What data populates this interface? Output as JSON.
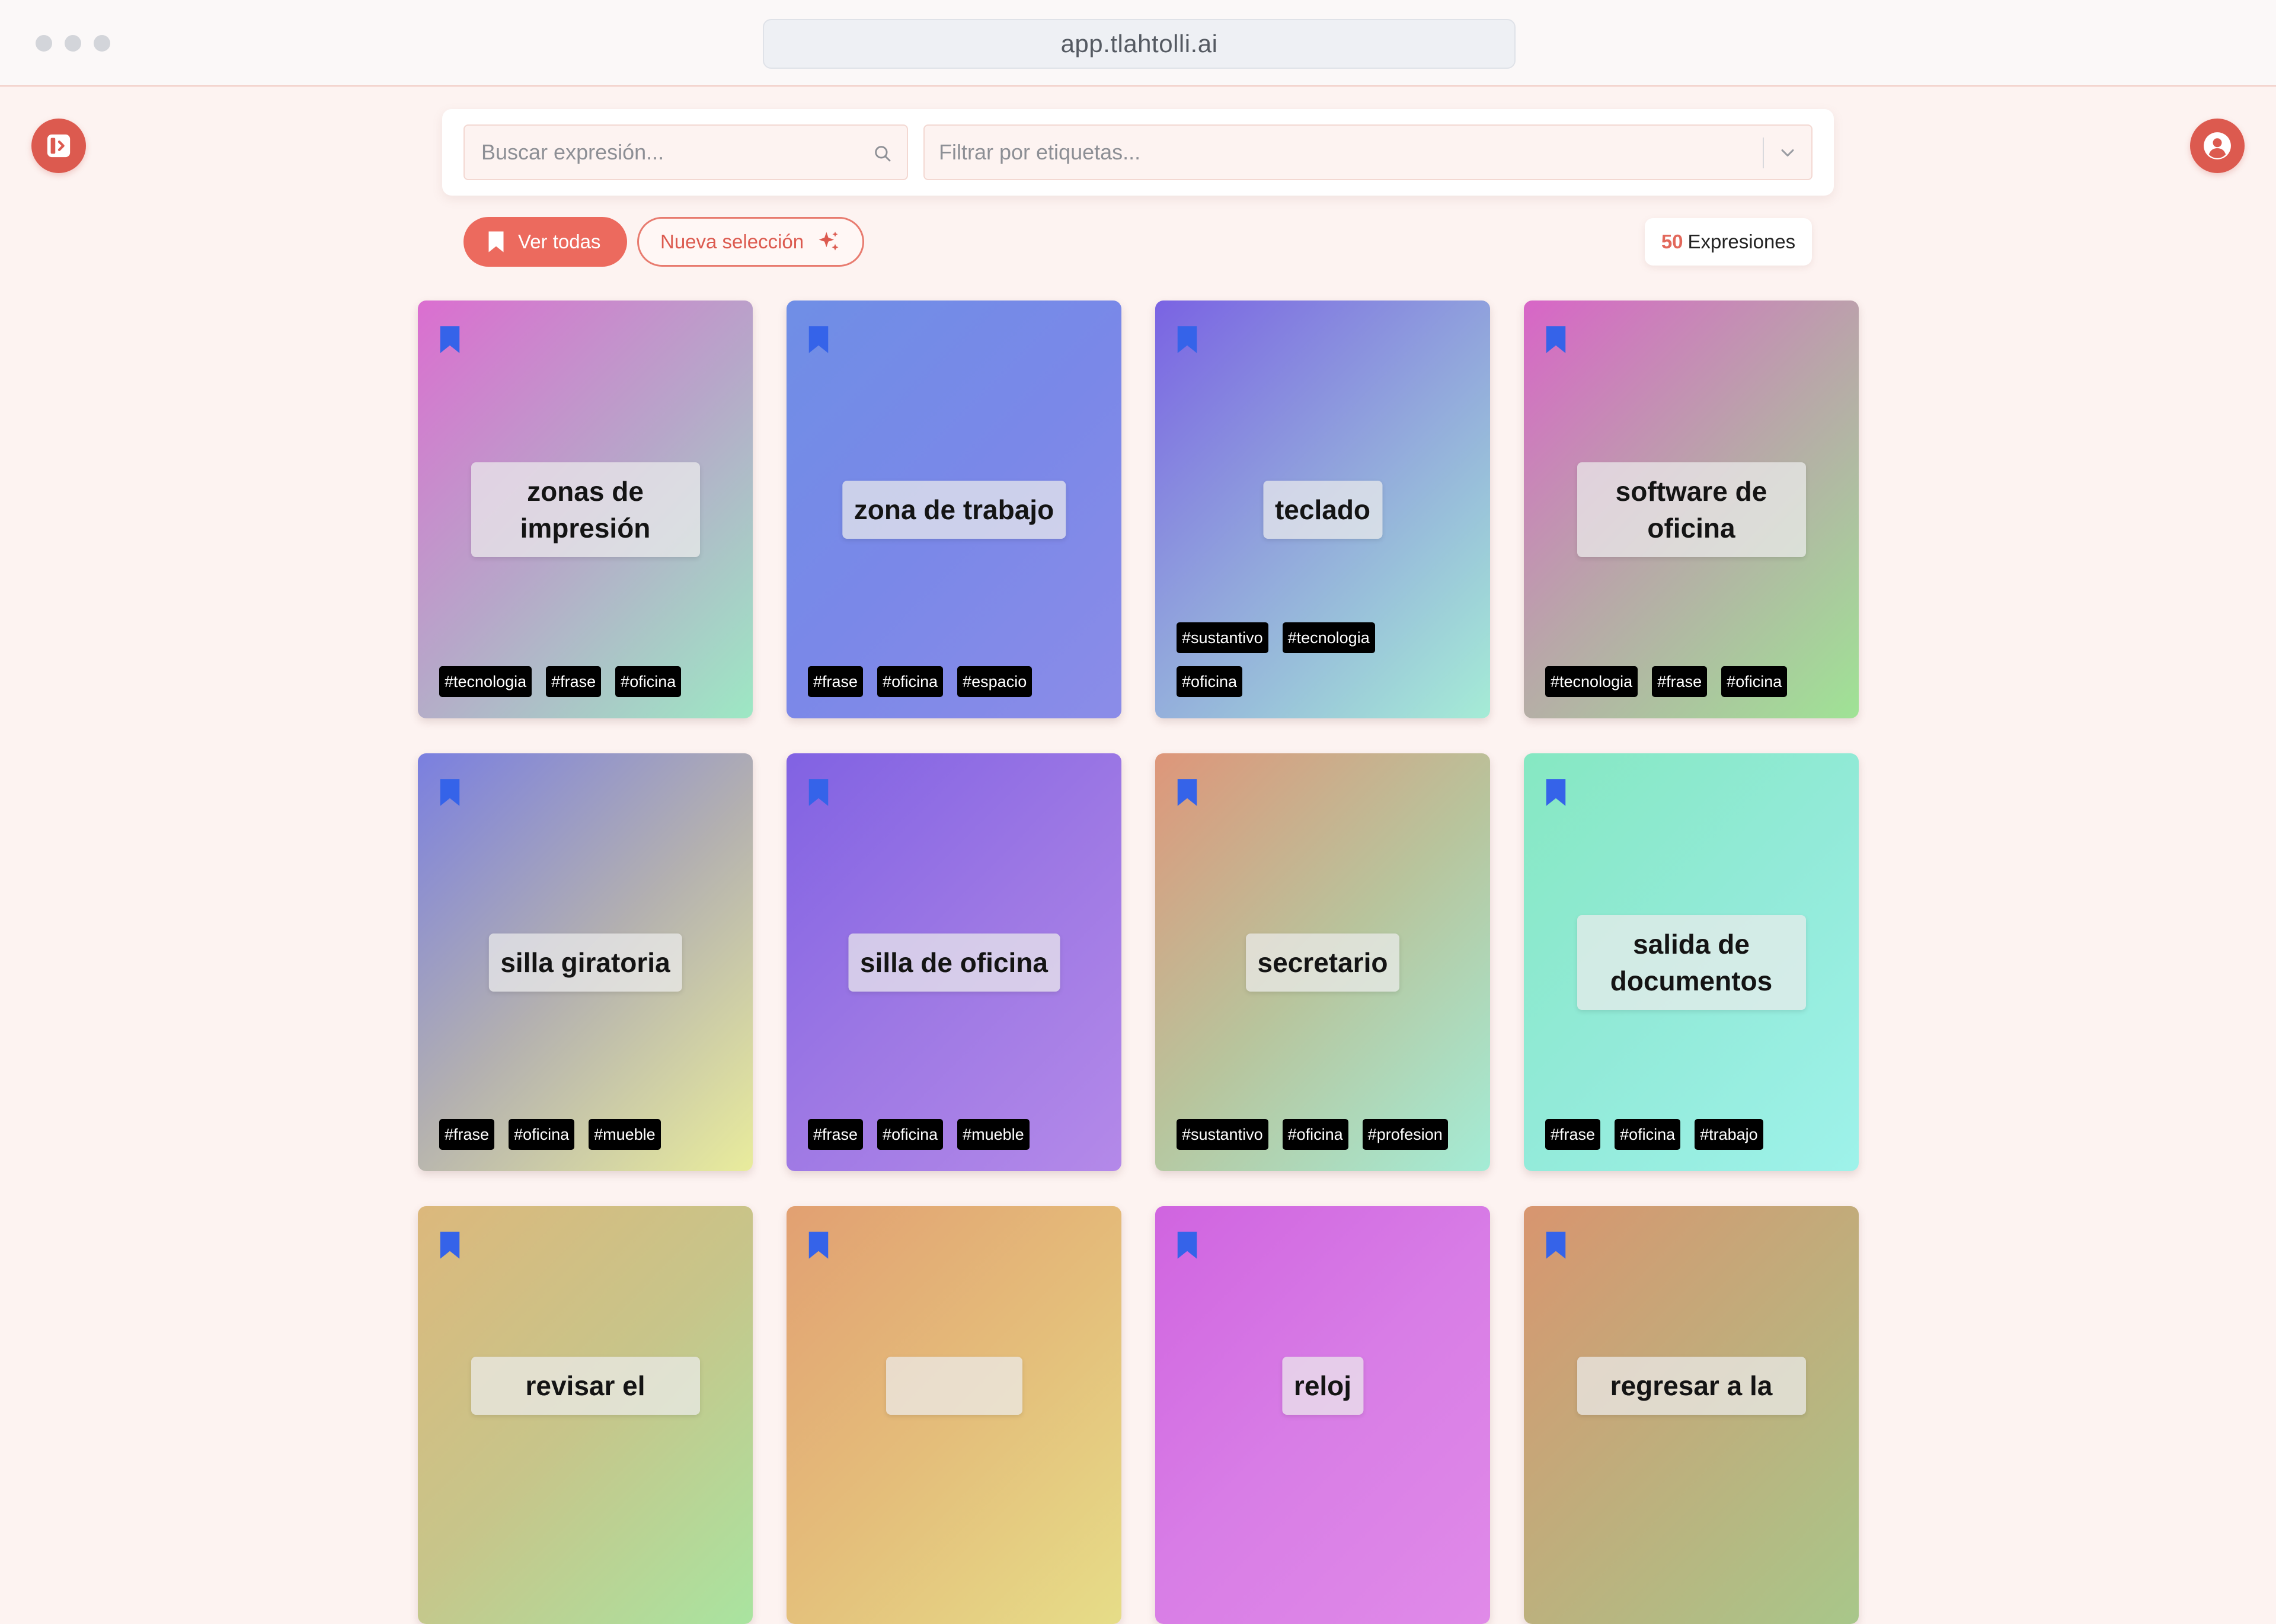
{
  "browser": {
    "url": "app.tlahtolli.ai"
  },
  "search": {
    "placeholder": "Buscar expresión...",
    "tag_filter_placeholder": "Filtrar por etiquetas..."
  },
  "actions": {
    "view_all_label": "Ver todas",
    "new_selection_label": "Nueva selección"
  },
  "counter": {
    "value": "50",
    "label": "Expresiones"
  },
  "cards": [
    {
      "text": "zonas de impresión",
      "tags": [
        "#tecnologia",
        "#frase",
        "#oficina"
      ]
    },
    {
      "text": "zona de trabajo",
      "tags": [
        "#frase",
        "#oficina",
        "#espacio"
      ]
    },
    {
      "text": "teclado",
      "tags": [
        "#sustantivo",
        "#tecnologia",
        "#oficina"
      ]
    },
    {
      "text": "software de oficina",
      "tags": [
        "#tecnologia",
        "#frase",
        "#oficina"
      ]
    },
    {
      "text": "silla giratoria",
      "tags": [
        "#frase",
        "#oficina",
        "#mueble"
      ]
    },
    {
      "text": "silla de oficina",
      "tags": [
        "#frase",
        "#oficina",
        "#mueble"
      ]
    },
    {
      "text": "secretario",
      "tags": [
        "#sustantivo",
        "#oficina",
        "#profesion"
      ]
    },
    {
      "text": "salida de documentos",
      "tags": [
        "#frase",
        "#oficina",
        "#trabajo"
      ]
    },
    {
      "text": "revisar el",
      "tags": []
    },
    {
      "text": "",
      "tags": []
    },
    {
      "text": "reloj",
      "tags": []
    },
    {
      "text": "regresar a la",
      "tags": []
    }
  ],
  "colors": {
    "accent": "#ec6a5e",
    "bookmark": "#3563e9",
    "background": "#fdf3f1"
  },
  "icons": {
    "sidebar_toggle": "sidebar-toggle-icon",
    "user": "user-avatar-icon",
    "search": "search-icon",
    "dropdown": "chevron-down-icon",
    "bookmark": "bookmark-icon",
    "sparkle": "sparkle-icon"
  }
}
